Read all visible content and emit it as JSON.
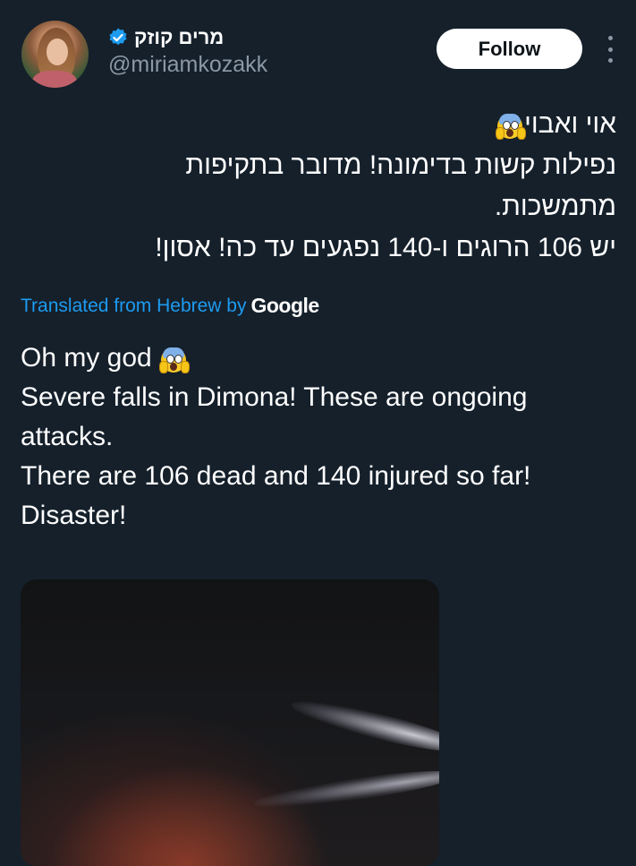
{
  "author": {
    "display_name": "מרים קוזק",
    "handle": "@miriamkozakk",
    "verified": true
  },
  "follow_label": "Follow",
  "tweet": {
    "hebrew_lines": [
      "אוי ואבוי",
      "נפילות קשות בדימונה! מדובר בתקיפות",
      "מתמשכות.",
      "יש 106 הרוגים ו-140 נפגעים עד כה! אסון!"
    ],
    "translation_label": "Translated from Hebrew by",
    "translation_provider": "Google",
    "english_lines": [
      "Oh my god",
      "Severe falls in Dimona! These are ongoing",
      "attacks.",
      "There are 106 dead and 140 injured so far!",
      "Disaster!"
    ]
  },
  "colors": {
    "background": "#15202b",
    "accent": "#1d9bf0",
    "muted": "#8b98a5"
  },
  "icons": [
    "verified-badge-icon",
    "more-options-icon",
    "screaming-face-emoji"
  ]
}
